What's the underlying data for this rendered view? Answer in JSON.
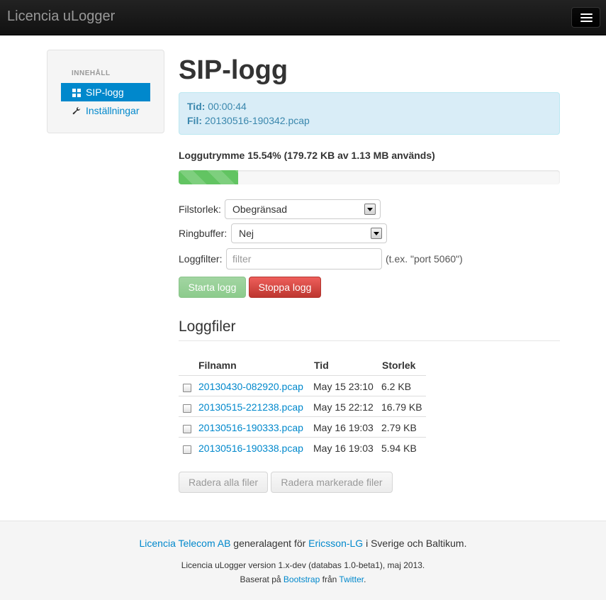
{
  "navbar": {
    "brand": "Licencia uLogger"
  },
  "sidebar": {
    "header": "INNEHÅLL",
    "items": [
      {
        "label": "SIP-logg",
        "icon": "grid-icon",
        "active": true
      },
      {
        "label": "Inställningar",
        "icon": "wrench-icon",
        "active": false
      }
    ]
  },
  "page": {
    "title": "SIP-logg"
  },
  "info": {
    "time_label": "Tid:",
    "time_value": "00:00:44",
    "file_label": "Fil:",
    "file_value": "20130516-190342.pcap"
  },
  "storage": {
    "text": "Loggutrymme 15.54% (179.72 KB av 1.13 MB används)",
    "used_percent": 15.54
  },
  "form": {
    "filesize_label": "Filstorlek:",
    "filesize_value": "Obegränsad",
    "ringbuffer_label": "Ringbuffer:",
    "ringbuffer_value": "Nej",
    "filter_label": "Loggfilter:",
    "filter_placeholder": "filter",
    "filter_help": "(t.ex. \"port 5060\")",
    "start_button": "Starta logg",
    "stop_button": "Stoppa logg"
  },
  "logfiles": {
    "title": "Loggfiler",
    "columns": [
      "Filnamn",
      "Tid",
      "Storlek"
    ],
    "rows": [
      {
        "name": "20130430-082920.pcap",
        "time": "May 15 23:10",
        "size": "6.2 KB"
      },
      {
        "name": "20130515-221238.pcap",
        "time": "May 15 22:12",
        "size": "16.79 KB"
      },
      {
        "name": "20130516-190333.pcap",
        "time": "May 16 19:03",
        "size": "2.79 KB"
      },
      {
        "name": "20130516-190338.pcap",
        "time": "May 16 19:03",
        "size": "5.94 KB"
      }
    ],
    "delete_all_button": "Radera alla filer",
    "delete_selected_button": "Radera markerade filer"
  },
  "footer": {
    "company_link": "Licencia Telecom AB",
    "text_mid": " generalagent för ",
    "brand_link": "Ericsson-LG",
    "text_end": " i Sverige och Baltikum.",
    "version": "Licencia uLogger version 1.x-dev (databas 1.0-beta1), maj 2013.",
    "based_prefix": "Baserat på ",
    "bootstrap_link": "Bootstrap",
    "based_mid": " från ",
    "twitter_link": "Twitter",
    "based_end": "."
  }
}
